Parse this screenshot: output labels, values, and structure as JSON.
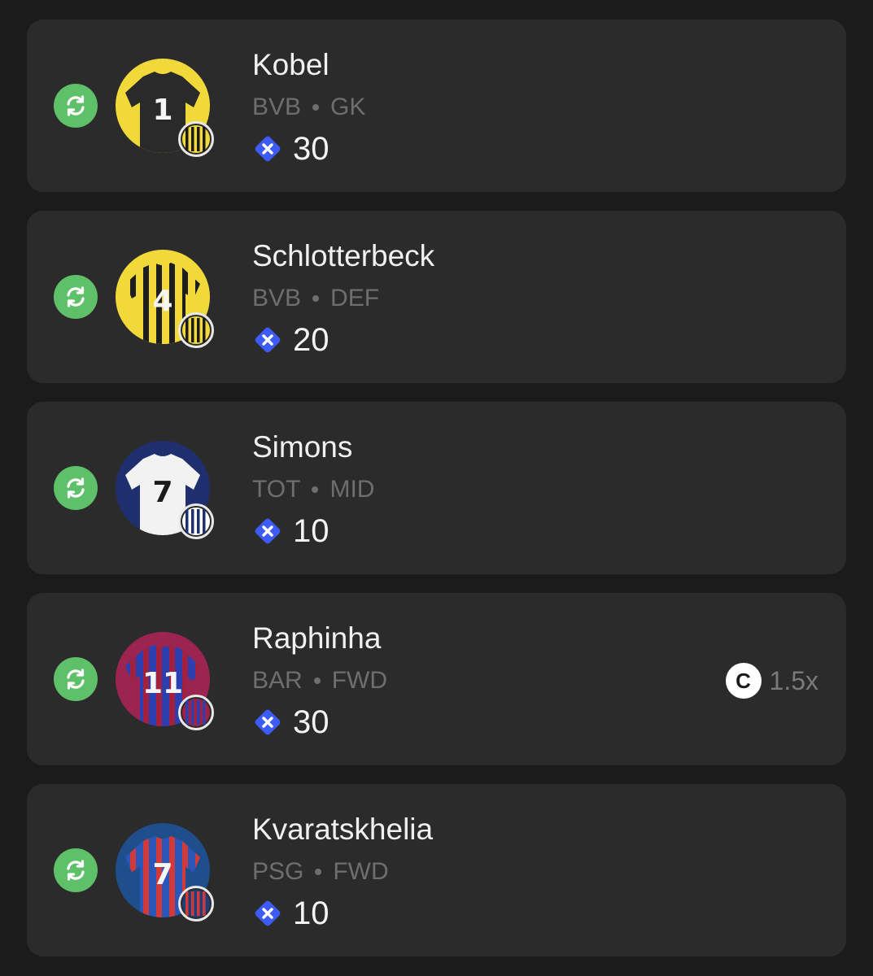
{
  "players": [
    {
      "name": "Kobel",
      "team": "BVB",
      "position": "GK",
      "price": "30",
      "avatar_bg": "#f1d93a",
      "shirt": "#2a2a2a",
      "stripe": "",
      "number": "1",
      "crest_colors": [
        "#f1d93a",
        "#1b1b1b"
      ],
      "captain": null
    },
    {
      "name": "Schlotterbeck",
      "team": "BVB",
      "position": "DEF",
      "price": "20",
      "avatar_bg": "#f1d93a",
      "shirt": "#f1d93a",
      "stripe": "#1e1e1e",
      "number": "4",
      "crest_colors": [
        "#f1d93a",
        "#1b1b1b"
      ],
      "captain": null
    },
    {
      "name": "Simons",
      "team": "TOT",
      "position": "MID",
      "price": "10",
      "avatar_bg": "#1f2f6e",
      "shirt": "#f2f2f2",
      "stripe": "",
      "number": "7",
      "crest_colors": [
        "#ffffff",
        "#1f2f6e"
      ],
      "captain": null
    },
    {
      "name": "Raphinha",
      "team": "BAR",
      "position": "FWD",
      "price": "30",
      "avatar_bg": "#9b2451",
      "shirt": "#2b3fb0",
      "stripe": "#a3203f",
      "number": "11",
      "crest_colors": [
        "#a3203f",
        "#2b3fb0"
      ],
      "captain": {
        "badge": "C",
        "multiplier": "1.5x"
      }
    },
    {
      "name": "Kvaratskhelia",
      "team": "PSG",
      "position": "FWD",
      "price": "10",
      "avatar_bg": "#1f4e8c",
      "shirt": "#2a56b8",
      "stripe": "#d23a3a",
      "number": "7",
      "crest_colors": [
        "#1f3f7a",
        "#d23a3a"
      ],
      "captain": null
    }
  ],
  "colors": {
    "card_bg": "#2b2b2b",
    "page_bg": "#1b1b1b",
    "swap_green": "#5fc06a",
    "price_icon": "#3d5bf5"
  },
  "icons": {
    "swap": "swap-arrows-icon",
    "price": "currency-x-icon",
    "captain": "captain-badge-icon"
  }
}
